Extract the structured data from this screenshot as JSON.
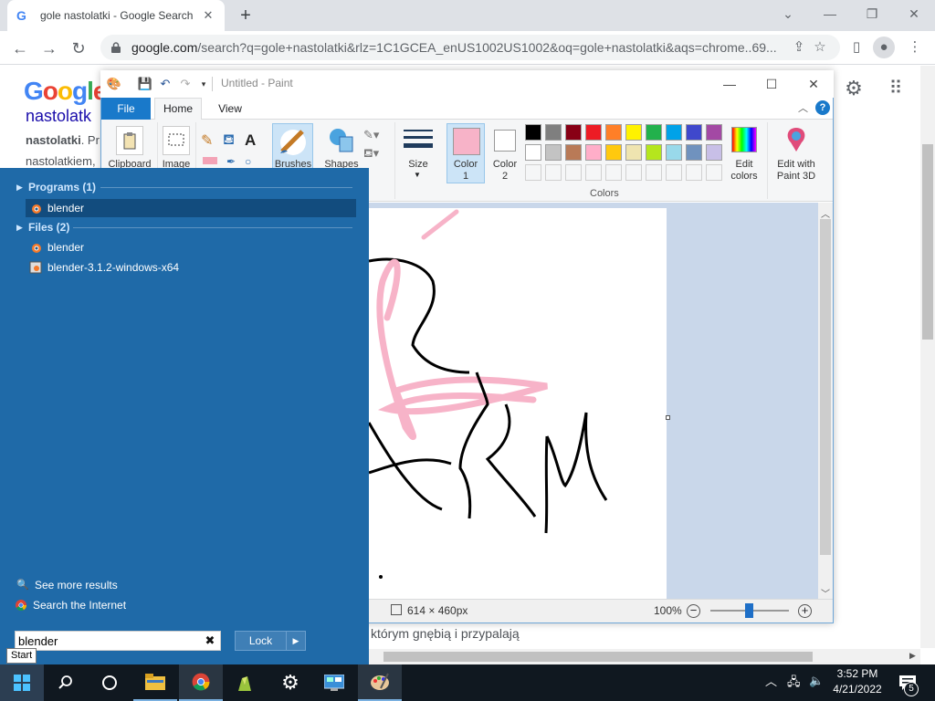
{
  "browser": {
    "tab_title": "gole nastolatki - Google Search",
    "tab_close": "✕",
    "new_tab": "+",
    "url_host": "google.com",
    "url_path": "/search?q=gole+nastolatki&rlz=1C1GCEA_enUS1002US1002&oq=gole+nastolatki&aqs=chrome..69..."
  },
  "google": {
    "logo": "Google",
    "result_title": "nastolatk",
    "snippet_bold": "nastolatki",
    "snippet_rest": ". Pr",
    "snippet_line2": "nastolatkiem,",
    "snippet_line3": "którym gnębią i przypalają"
  },
  "paint": {
    "title": "Untitled - Paint",
    "tabs": {
      "file": "File",
      "home": "Home",
      "view": "View"
    },
    "groups": {
      "clipboard": "Clipboard",
      "image": "Image",
      "brushes": "Brushes",
      "shapes": "Shapes",
      "size": "Size",
      "color1": "Color\n1",
      "color2": "Color\n2",
      "edit_colors": "Edit\ncolors",
      "paint3d": "Edit with\nPaint 3D",
      "colors_label": "Colors",
      "text_tool": "A"
    },
    "palette_row1": [
      "#000000",
      "#7f7f7f",
      "#880015",
      "#ed1c24",
      "#ff7f27",
      "#fff200",
      "#22b14c",
      "#00a2e8",
      "#3f48cc",
      "#a349a4"
    ],
    "palette_row2": [
      "#ffffff",
      "#c3c3c3",
      "#b97a57",
      "#ffaec9",
      "#ffc90e",
      "#efe4b0",
      "#b5e61d",
      "#99d9ea",
      "#7092be",
      "#c8bfe7"
    ],
    "status_dims": "614 × 460px",
    "zoom": "100%"
  },
  "start_menu": {
    "programs_header": "Programs (1)",
    "files_header": "Files (2)",
    "program_items": [
      "blender"
    ],
    "file_items": [
      "blender",
      "blender-3.1.2-windows-x64"
    ],
    "see_more": "See more results",
    "search_internet": "Search the Internet",
    "search_value": "blender",
    "lock_label": "Lock",
    "tooltip": "Start"
  },
  "taskbar": {
    "time": "3:52 PM",
    "date": "4/21/2022",
    "notification_count": "5"
  },
  "colors": {
    "start_bg": "#1f6aa8",
    "taskbar_bg": "#101820",
    "paint_accent": "#1979ca",
    "pink": "#f7b3c8"
  }
}
